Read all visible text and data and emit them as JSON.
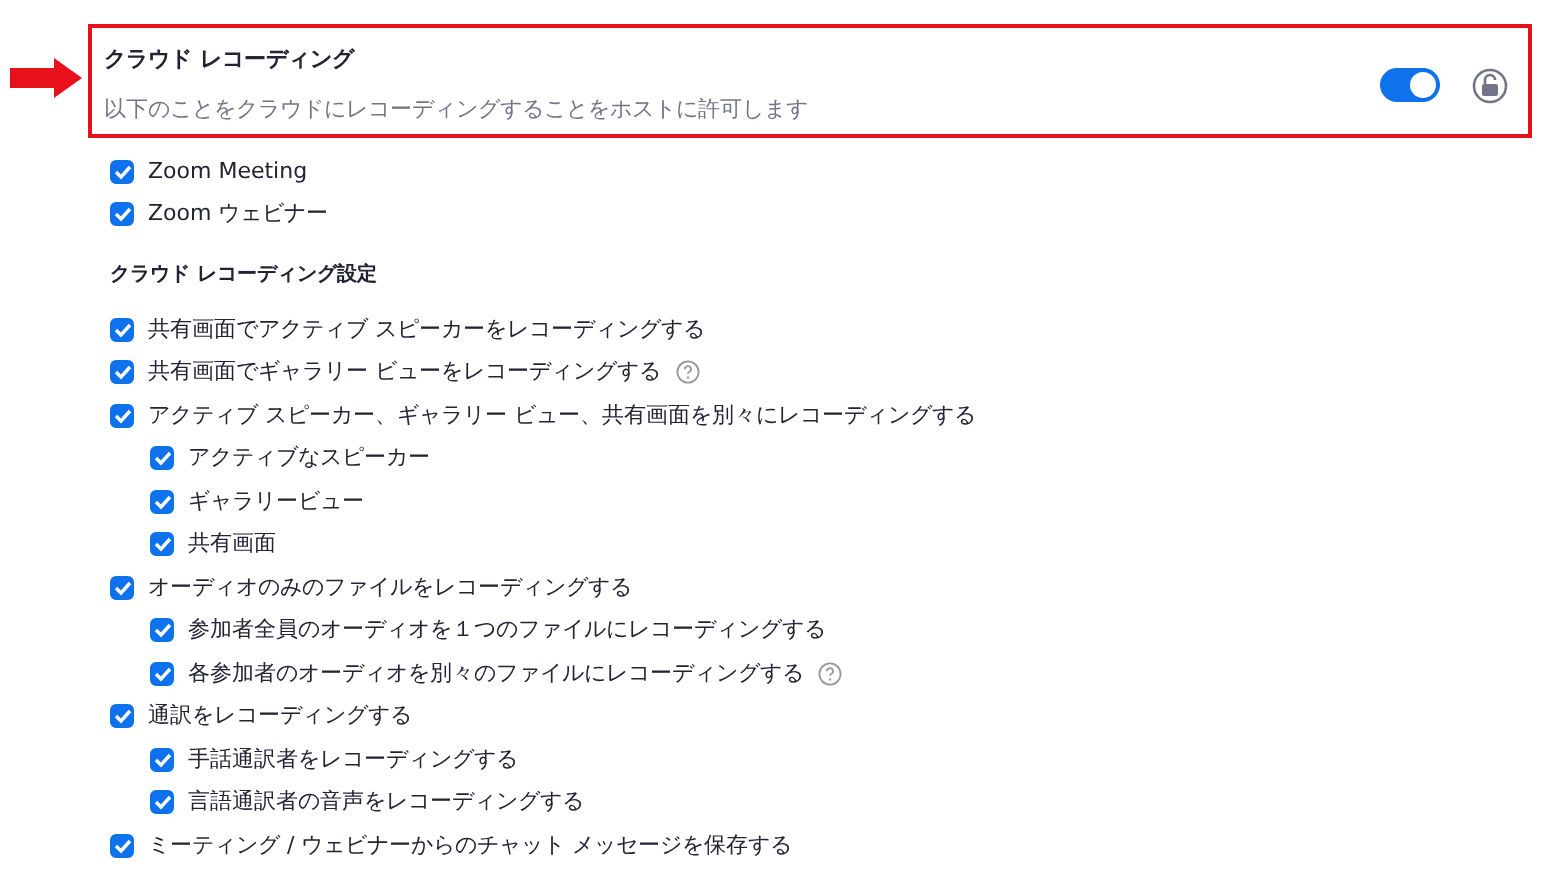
{
  "setting": {
    "title": "クラウド レコーディング",
    "description": "以下のことをクラウドにレコーディングすることをホストに許可します",
    "on": true,
    "locked": false,
    "highlighted": true
  },
  "targets": [
    {
      "label": "Zoom Meeting",
      "checked": true
    },
    {
      "label": "Zoom ウェビナー",
      "checked": true
    }
  ],
  "settings_heading": "クラウド レコーディング設定",
  "options": [
    {
      "label": "共有画面でアクティブ スピーカーをレコーディングする",
      "checked": true,
      "help": false
    },
    {
      "label": "共有画面でギャラリー ビューをレコーディングする",
      "checked": true,
      "help": true
    },
    {
      "label": "アクティブ スピーカー、ギャラリー ビュー、共有画面を別々にレコーディングする",
      "checked": true,
      "help": false,
      "children": [
        {
          "label": "アクティブなスピーカー",
          "checked": true,
          "help": false
        },
        {
          "label": "ギャラリービュー",
          "checked": true,
          "help": false
        },
        {
          "label": "共有画面",
          "checked": true,
          "help": false
        }
      ]
    },
    {
      "label": "オーディオのみのファイルをレコーディングする",
      "checked": true,
      "help": false,
      "children": [
        {
          "label": "参加者全員のオーディオを１つのファイルにレコーディングする",
          "checked": true,
          "help": false
        },
        {
          "label": "各参加者のオーディオを別々のファイルにレコーディングする",
          "checked": true,
          "help": true
        }
      ]
    },
    {
      "label": "通訳をレコーディングする",
      "checked": true,
      "help": false,
      "children": [
        {
          "label": "手話通訳者をレコーディングする",
          "checked": true,
          "help": false
        },
        {
          "label": "言語通訳者の音声をレコーディングする",
          "checked": true,
          "help": false
        }
      ]
    },
    {
      "label": "ミーティング / ウェビナーからのチャット メッセージを保存する",
      "checked": true,
      "help": false
    }
  ]
}
